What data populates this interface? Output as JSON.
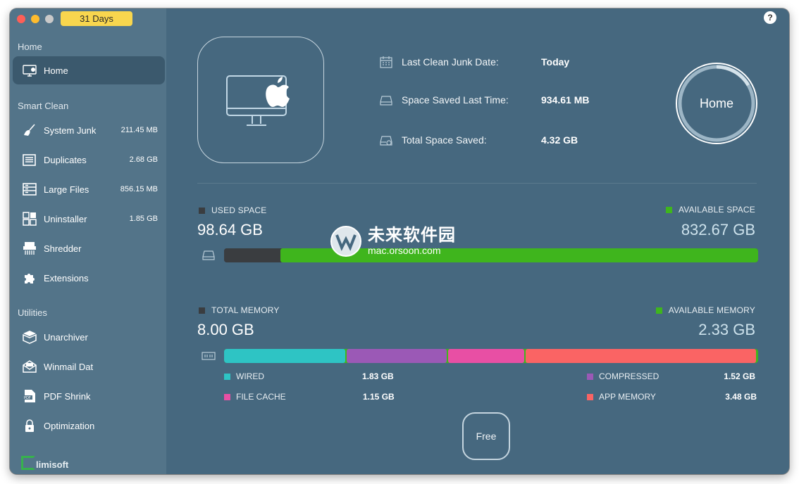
{
  "window": {
    "trial_badge": "31 Days",
    "help_label": "?"
  },
  "sidebar": {
    "sections": [
      {
        "title": "Home"
      },
      {
        "title": "Smart Clean"
      },
      {
        "title": "Utilities"
      }
    ],
    "items": [
      {
        "label": "Home",
        "size": "",
        "icon": "imac-icon"
      },
      {
        "label": "System Junk",
        "size": "211.45 MB",
        "icon": "broom-icon"
      },
      {
        "label": "Duplicates",
        "size": "2.68 GB",
        "icon": "duplicates-icon"
      },
      {
        "label": "Large Files",
        "size": "856.15 MB",
        "icon": "cabinet-icon"
      },
      {
        "label": "Uninstaller",
        "size": "1.85 GB",
        "icon": "apps-grid-icon"
      },
      {
        "label": "Shredder",
        "size": "",
        "icon": "shredder-icon"
      },
      {
        "label": "Extensions",
        "size": "",
        "icon": "puzzle-icon"
      },
      {
        "label": "Unarchiver",
        "size": "",
        "icon": "box-icon"
      },
      {
        "label": "Winmail Dat",
        "size": "",
        "icon": "envelope-icon"
      },
      {
        "label": "PDF Shrink",
        "size": "",
        "icon": "pdf-icon"
      },
      {
        "label": "Optimization",
        "size": "",
        "icon": "lock-icon"
      }
    ],
    "brand": "limisoft"
  },
  "info": {
    "last_clean_label": "Last Clean Junk Date:",
    "last_clean_value": "Today",
    "saved_last_label": "Space Saved Last Time:",
    "saved_last_value": "934.61 MB",
    "total_saved_label": "Total Space Saved:",
    "total_saved_value": "4.32 GB"
  },
  "home_button": {
    "label": "Home"
  },
  "disk": {
    "used_label": "USED SPACE",
    "used_value": "98.64 GB",
    "available_label": "AVAILABLE SPACE",
    "available_value": "832.67 GB",
    "used_fraction": 0.106
  },
  "memory": {
    "total_label": "TOTAL MEMORY",
    "total_value": "8.00 GB",
    "available_label": "AVAILABLE MEMORY",
    "available_value": "2.33 GB",
    "legend": [
      {
        "label": "WIRED",
        "value": "1.83 GB",
        "color": "#2ec4c4"
      },
      {
        "label": "COMPRESSED",
        "value": "1.52 GB",
        "color": "#9b59b6"
      },
      {
        "label": "FILE CACHE",
        "value": "1.15 GB",
        "color": "#e84fa4"
      },
      {
        "label": "APP MEMORY",
        "value": "3.48 GB",
        "color": "#fa6464"
      }
    ]
  },
  "free_button": {
    "label": "Free"
  },
  "colors": {
    "used": "#3a3d40",
    "available": "#3fb51d",
    "accent_yellow": "#f8d64e"
  },
  "watermark": {
    "title": "未来软件园",
    "url": "mac.orsoon.com"
  }
}
